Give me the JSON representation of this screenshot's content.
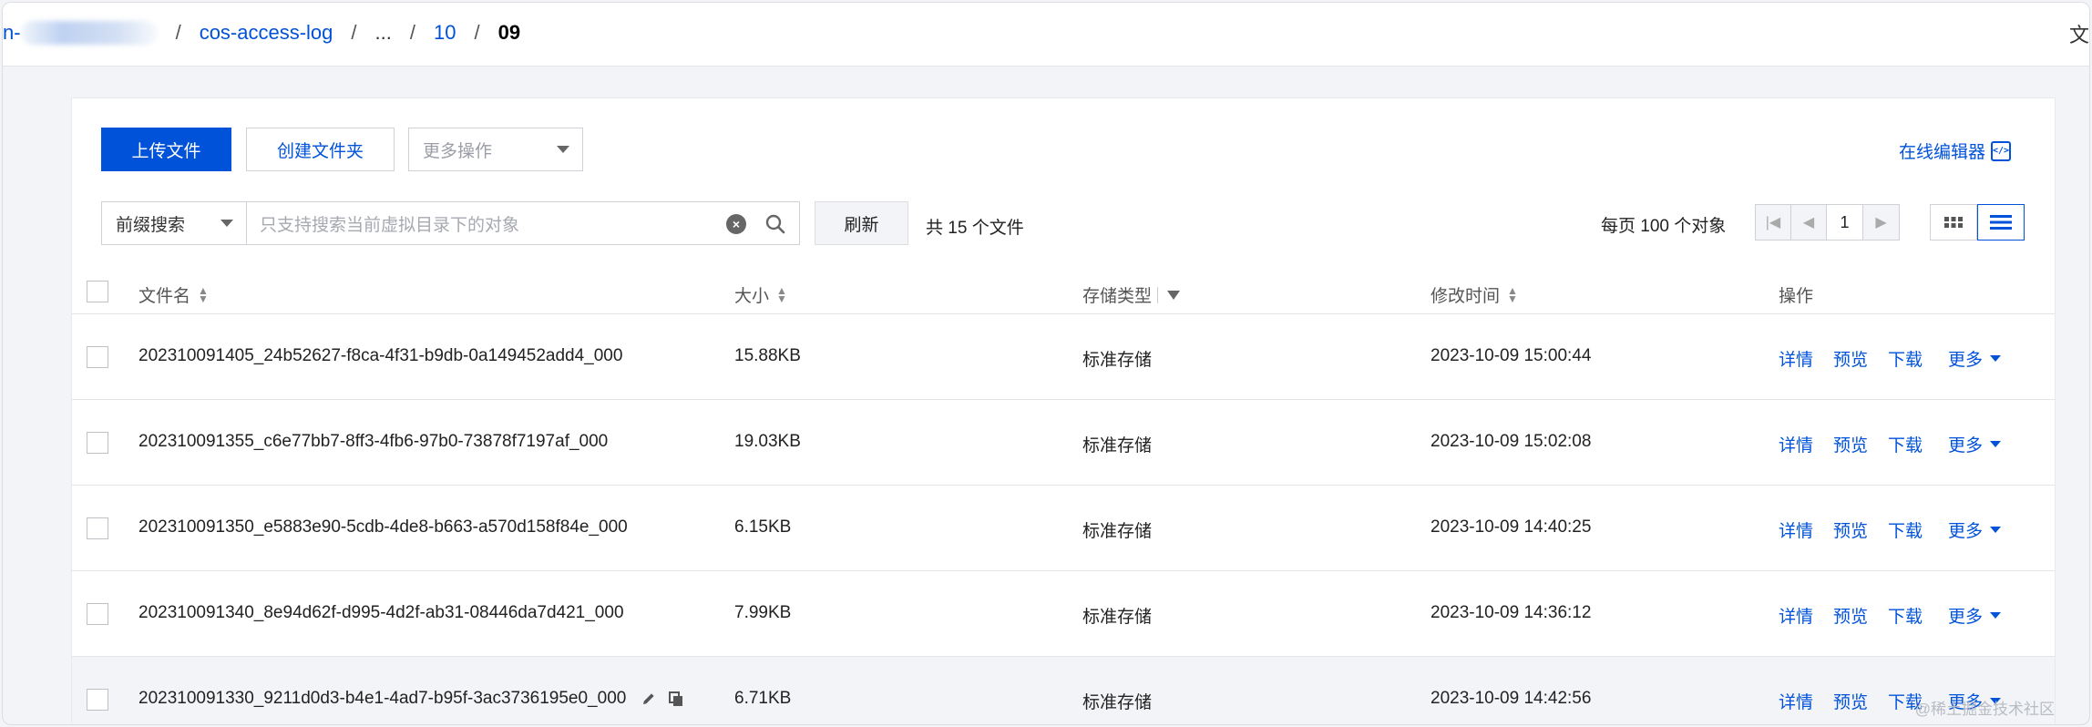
{
  "breadcrumb": {
    "prefix_fragment": "n-",
    "items": [
      {
        "label": "cos-access-log",
        "link": true
      },
      {
        "label": "...",
        "link": false
      },
      {
        "label": "10",
        "link": true
      },
      {
        "label": "09",
        "link": false,
        "current": true
      }
    ],
    "separator": "/",
    "right_char": "文"
  },
  "toolbar": {
    "upload_label": "上传文件",
    "create_folder_label": "创建文件夹",
    "more_actions_label": "更多操作",
    "online_editor_label": "在线编辑器",
    "online_editor_icon": "code-editor-icon"
  },
  "search": {
    "prefix_label": "前缀搜索",
    "placeholder": "只支持搜索当前虚拟目录下的对象",
    "refresh_label": "刷新",
    "total_text": "共 15 个文件"
  },
  "pagination": {
    "per_page_text": "每页 100 个对象",
    "current_page": "1"
  },
  "table": {
    "headers": {
      "name": "文件名",
      "size": "大小",
      "storage_class": "存储类型",
      "modified": "修改时间",
      "actions": "操作"
    },
    "actions": {
      "detail": "详情",
      "preview": "预览",
      "download": "下载",
      "more": "更多"
    },
    "rows": [
      {
        "name": "202310091405_24b52627-f8ca-4f31-b9db-0a149452add4_000",
        "size": "15.88KB",
        "storage_class": "标准存储",
        "modified": "2023-10-09 15:00:44"
      },
      {
        "name": "202310091355_c6e77bb7-8ff3-4fb6-97b0-73878f7197af_000",
        "size": "19.03KB",
        "storage_class": "标准存储",
        "modified": "2023-10-09 15:02:08"
      },
      {
        "name": "202310091350_e5883e90-5cdb-4de8-b663-a570d158f84e_000",
        "size": "6.15KB",
        "storage_class": "标准存储",
        "modified": "2023-10-09 14:40:25"
      },
      {
        "name": "202310091340_8e94d62f-d995-4d2f-ab31-08446da7d421_000",
        "size": "7.99KB",
        "storage_class": "标准存储",
        "modified": "2023-10-09 14:36:12"
      },
      {
        "name": "202310091330_9211d0d3-b4e1-4ad7-b95f-3ac3736195e0_000",
        "size": "6.71KB",
        "storage_class": "标准存储",
        "modified": "2023-10-09 14:42:56"
      }
    ]
  },
  "watermark": "@稀土掘金技术社区",
  "colors": {
    "primary": "#0052d9",
    "border": "#cfd1d6",
    "background": "#f3f4f7"
  }
}
